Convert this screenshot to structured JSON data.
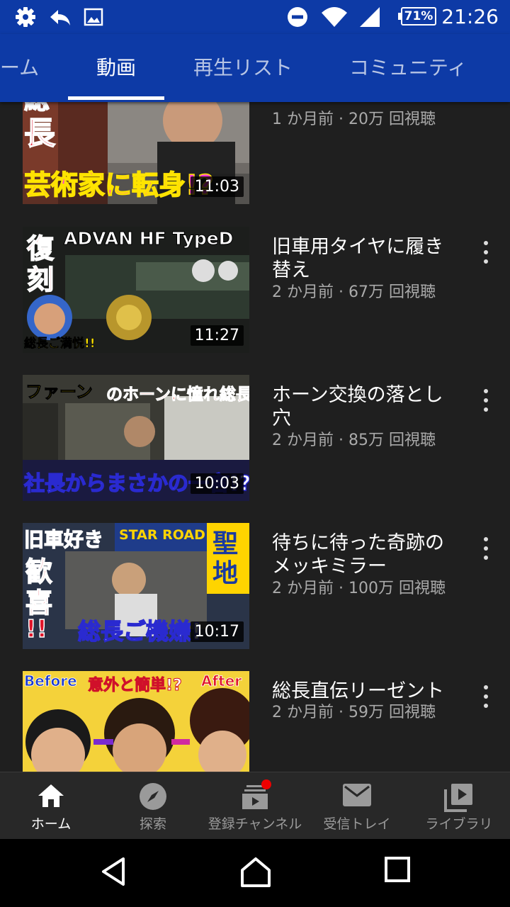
{
  "status_bar": {
    "time": "21:26",
    "battery": "71%",
    "icons": [
      "settings-gear-icon",
      "reply-arrow-icon",
      "image-icon",
      "do-not-disturb-icon",
      "wifi-icon",
      "signal-icon",
      "battery-icon"
    ]
  },
  "tabs": {
    "items": [
      {
        "label": "ーム",
        "active": false
      },
      {
        "label": "動画",
        "active": true
      },
      {
        "label": "再生リスト",
        "active": false
      },
      {
        "label": "コミュニティ",
        "active": false
      }
    ]
  },
  "videos": [
    {
      "title": "",
      "meta": "1 か月前 · 20万 回視聴",
      "duration": "11:03",
      "thumb_text": [
        "総",
        "長",
        "芸術家に転身!?"
      ]
    },
    {
      "title": "旧車用タイヤに履き替え",
      "meta": "2 か月前 · 67万 回視聴",
      "duration": "11:27",
      "thumb_text": [
        "復",
        "刻",
        "ADVAN HF TypeD",
        "総長ご満悦!!"
      ]
    },
    {
      "title": "ホーン交換の落とし穴",
      "meta": "2 か月前 · 85万 回視聴",
      "duration": "10:03",
      "thumb_text": [
        "ファーン",
        "のホーンに憧れ総長",
        "社長からまさかの一言!?"
      ]
    },
    {
      "title": "待ちに待った奇跡のメッキミラー",
      "meta": "2 か月前 · 100万 回視聴",
      "duration": "10:17",
      "thumb_text": [
        "旧車好き",
        "歓",
        "喜",
        "!!",
        "STAR ROAD",
        "聖",
        "地",
        "総長ご機嫌!"
      ]
    },
    {
      "title": "総長直伝リーゼント",
      "meta": "2 か月前 · 59万 回視聴",
      "duration": "",
      "thumb_text": [
        "Before",
        "意外と簡単!?",
        "After"
      ]
    }
  ],
  "bottom_nav": [
    {
      "label": "ホーム",
      "icon": "home-icon",
      "active": true
    },
    {
      "label": "探索",
      "icon": "compass-icon",
      "active": false
    },
    {
      "label": "登録チャンネル",
      "icon": "subscriptions-icon",
      "active": false
    },
    {
      "label": "受信トレイ",
      "icon": "mail-icon",
      "active": false
    },
    {
      "label": "ライブラリ",
      "icon": "library-icon",
      "active": false
    }
  ],
  "system_nav": [
    "back-icon",
    "home-circle-icon",
    "recents-icon"
  ]
}
